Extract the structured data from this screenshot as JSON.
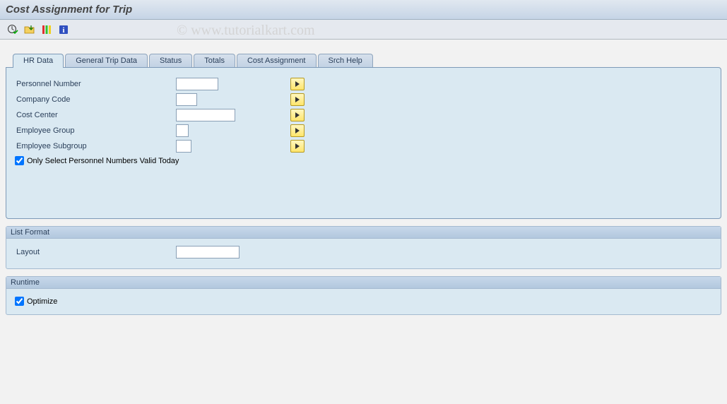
{
  "title": "Cost Assignment for Trip",
  "watermark": "© www.tutorialkart.com",
  "toolbar": {
    "execute": "execute-icon",
    "variant": "variant-icon",
    "dynsel": "dynsel-icon",
    "info": "info-icon"
  },
  "tabs": [
    {
      "id": "hr",
      "label": "HR Data",
      "active": true
    },
    {
      "id": "general",
      "label": "General Trip Data",
      "active": false
    },
    {
      "id": "status",
      "label": "Status",
      "active": false
    },
    {
      "id": "totals",
      "label": "Totals",
      "active": false
    },
    {
      "id": "cost",
      "label": "Cost Assignment",
      "active": false
    },
    {
      "id": "srch",
      "label": "Srch Help",
      "active": false
    }
  ],
  "hrPanel": {
    "rows": [
      {
        "label": "Personnel Number",
        "value": "",
        "width": "input-w1"
      },
      {
        "label": "Company Code",
        "value": "",
        "width": "input-w2"
      },
      {
        "label": "Cost Center",
        "value": "",
        "width": "input-w3"
      },
      {
        "label": "Employee Group",
        "value": "",
        "width": "input-w4"
      },
      {
        "label": "Employee Subgroup",
        "value": "",
        "width": "input-w5"
      }
    ],
    "checkbox": {
      "label": "Only Select Personnel Numbers Valid Today",
      "checked": true
    }
  },
  "listFormat": {
    "groupTitle": "List Format",
    "layoutLabel": "Layout",
    "layoutValue": ""
  },
  "runtime": {
    "groupTitle": "Runtime",
    "optimizeLabel": "Optimize",
    "optimizeChecked": true
  }
}
